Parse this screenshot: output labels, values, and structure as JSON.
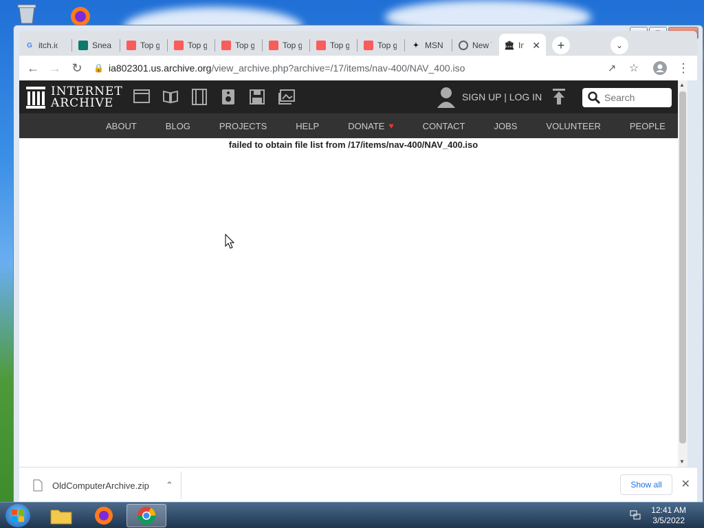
{
  "browser": {
    "tabs": [
      {
        "title": "itch.io",
        "favicon": "G",
        "color": "#4285f4"
      },
      {
        "title": "Sneaker",
        "favicon": "S",
        "color": "#0b7a6b"
      },
      {
        "title": "Top games",
        "favicon": "itch",
        "color": "#fa5c5c"
      },
      {
        "title": "Top games",
        "favicon": "itch",
        "color": "#fa5c5c"
      },
      {
        "title": "Top games",
        "favicon": "itch",
        "color": "#fa5c5c"
      },
      {
        "title": "Top games",
        "favicon": "itch",
        "color": "#fa5c5c"
      },
      {
        "title": "Top games",
        "favicon": "itch",
        "color": "#fa5c5c"
      },
      {
        "title": "Top games",
        "favicon": "itch",
        "color": "#fa5c5c"
      },
      {
        "title": "MSN",
        "favicon": "msn",
        "color": "#111"
      },
      {
        "title": "New Tab",
        "favicon": "chrome",
        "color": "#5f6368"
      },
      {
        "title": "Internet Archive",
        "favicon": "ia",
        "color": "#222",
        "active": true
      }
    ],
    "url_host": "ia802301.us.archive.org",
    "url_path": "/view_archive.php?archive=/17/items/nav-400/NAV_400.iso"
  },
  "ia": {
    "logo_line1": "INTERNET",
    "logo_line2": "ARCHIVE",
    "auth": "SIGN UP | LOG IN",
    "search_placeholder": "Search",
    "nav": [
      "ABOUT",
      "BLOG",
      "PROJECTS",
      "HELP",
      "DONATE",
      "CONTACT",
      "JOBS",
      "VOLUNTEER",
      "PEOPLE"
    ],
    "donate_heart_color": "#e53935"
  },
  "main": {
    "error": "failed to obtain file list from /17/items/nav-400/NAV_400.iso"
  },
  "downloads": {
    "file": "OldComputerArchive.zip",
    "show_all": "Show all"
  },
  "taskbar": {
    "time": "12:41 AM",
    "date": "3/5/2022"
  }
}
